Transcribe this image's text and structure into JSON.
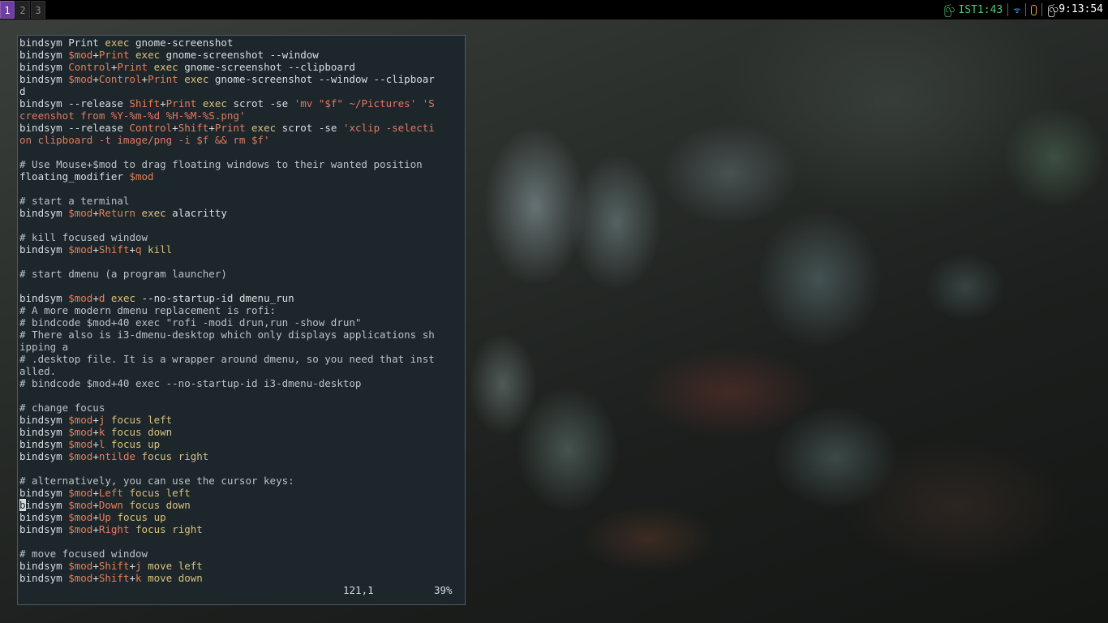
{
  "workspaces": [
    "1",
    "2",
    "3"
  ],
  "active_workspace": "1",
  "status": {
    "cpu": "IST1:43",
    "cpu_icon": "ꩺ",
    "wifi_icon": "ᯤ",
    "temp_icon": "🌡",
    "clock": "ꩺ9:13:54"
  },
  "colors": {
    "bar_bg": "#000000",
    "active_ws": "#6f3f9f",
    "terminal_bg": "#1d262b",
    "variable": "#e67e5a",
    "keyword": "#d8c27a"
  },
  "editor": {
    "cursor_position": "121,1",
    "scroll_percent": "39%",
    "lines": [
      [
        [
          "t",
          "bindsym Print "
        ],
        [
          "k",
          "exec"
        ],
        [
          "t",
          " gnome-screenshot"
        ]
      ],
      [
        [
          "t",
          "bindsym "
        ],
        [
          "v",
          "$mod"
        ],
        [
          "t",
          "+"
        ],
        [
          "v",
          "Print"
        ],
        [
          "t",
          " "
        ],
        [
          "k",
          "exec"
        ],
        [
          "t",
          " gnome-screenshot --window"
        ]
      ],
      [
        [
          "t",
          "bindsym "
        ],
        [
          "v",
          "Control"
        ],
        [
          "t",
          "+"
        ],
        [
          "v",
          "Print"
        ],
        [
          "t",
          " "
        ],
        [
          "k",
          "exec"
        ],
        [
          "t",
          " gnome-screenshot --clipboard"
        ]
      ],
      [
        [
          "t",
          "bindsym "
        ],
        [
          "v",
          "$mod"
        ],
        [
          "t",
          "+"
        ],
        [
          "v",
          "Control"
        ],
        [
          "t",
          "+"
        ],
        [
          "v",
          "Print"
        ],
        [
          "t",
          " "
        ],
        [
          "k",
          "exec"
        ],
        [
          "t",
          " gnome-screenshot --window --clipboar"
        ]
      ],
      [
        [
          "t",
          "d"
        ]
      ],
      [
        [
          "t",
          "bindsym --release "
        ],
        [
          "v",
          "Shift"
        ],
        [
          "t",
          "+"
        ],
        [
          "v",
          "Print"
        ],
        [
          "t",
          " "
        ],
        [
          "k",
          "exec"
        ],
        [
          "t",
          " scrot -se "
        ],
        [
          "s",
          "'mv \"$f\" ~/Pictures' 'S"
        ]
      ],
      [
        [
          "s",
          "creenshot from %Y-%m-%d %H-%M-%S.png'"
        ]
      ],
      [
        [
          "t",
          "bindsym --release "
        ],
        [
          "v",
          "Control"
        ],
        [
          "t",
          "+"
        ],
        [
          "v",
          "Shift"
        ],
        [
          "t",
          "+"
        ],
        [
          "v",
          "Print"
        ],
        [
          "t",
          " "
        ],
        [
          "k",
          "exec"
        ],
        [
          "t",
          " scrot -se "
        ],
        [
          "s",
          "'xclip -selecti"
        ]
      ],
      [
        [
          "s",
          "on clipboard -t image/png -i $f && rm $f'"
        ]
      ],
      [
        [
          "t",
          ""
        ]
      ],
      [
        [
          "c",
          "# Use Mouse+$mod to drag floating windows to their wanted position"
        ]
      ],
      [
        [
          "t",
          "floating_modifier "
        ],
        [
          "v",
          "$mod"
        ]
      ],
      [
        [
          "t",
          ""
        ]
      ],
      [
        [
          "c",
          "# start a terminal"
        ]
      ],
      [
        [
          "t",
          "bindsym "
        ],
        [
          "v",
          "$mod"
        ],
        [
          "t",
          "+"
        ],
        [
          "v",
          "Return"
        ],
        [
          "t",
          " "
        ],
        [
          "k",
          "exec"
        ],
        [
          "t",
          " alacritty"
        ]
      ],
      [
        [
          "t",
          ""
        ]
      ],
      [
        [
          "c",
          "# kill focused window"
        ]
      ],
      [
        [
          "t",
          "bindsym "
        ],
        [
          "v",
          "$mod"
        ],
        [
          "t",
          "+"
        ],
        [
          "v",
          "Shift"
        ],
        [
          "t",
          "+"
        ],
        [
          "v",
          "q"
        ],
        [
          "t",
          " "
        ],
        [
          "k",
          "kill"
        ]
      ],
      [
        [
          "t",
          ""
        ]
      ],
      [
        [
          "c",
          "# start dmenu (a program launcher)"
        ]
      ],
      [
        [
          "t",
          ""
        ]
      ],
      [
        [
          "t",
          "bindsym "
        ],
        [
          "v",
          "$mod"
        ],
        [
          "t",
          "+"
        ],
        [
          "v",
          "d"
        ],
        [
          "t",
          " "
        ],
        [
          "k",
          "exec"
        ],
        [
          "t",
          " --no-startup-id dmenu_run"
        ]
      ],
      [
        [
          "c",
          "# A more modern dmenu replacement is rofi:"
        ]
      ],
      [
        [
          "c",
          "# bindcode $mod+40 exec \"rofi -modi drun,run -show drun\""
        ]
      ],
      [
        [
          "c",
          "# There also is i3-dmenu-desktop which only displays applications sh"
        ]
      ],
      [
        [
          "c",
          "ipping a"
        ]
      ],
      [
        [
          "c",
          "# .desktop file. It is a wrapper around dmenu, so you need that inst"
        ]
      ],
      [
        [
          "c",
          "alled."
        ]
      ],
      [
        [
          "c",
          "# bindcode $mod+40 exec --no-startup-id i3-dmenu-desktop"
        ]
      ],
      [
        [
          "t",
          ""
        ]
      ],
      [
        [
          "c",
          "# change focus"
        ]
      ],
      [
        [
          "t",
          "bindsym "
        ],
        [
          "v",
          "$mod"
        ],
        [
          "t",
          "+"
        ],
        [
          "v",
          "j"
        ],
        [
          "t",
          " "
        ],
        [
          "k",
          "focus left"
        ]
      ],
      [
        [
          "t",
          "bindsym "
        ],
        [
          "v",
          "$mod"
        ],
        [
          "t",
          "+"
        ],
        [
          "v",
          "k"
        ],
        [
          "t",
          " "
        ],
        [
          "k",
          "focus down"
        ]
      ],
      [
        [
          "t",
          "bindsym "
        ],
        [
          "v",
          "$mod"
        ],
        [
          "t",
          "+"
        ],
        [
          "v",
          "l"
        ],
        [
          "t",
          " "
        ],
        [
          "k",
          "focus up"
        ]
      ],
      [
        [
          "t",
          "bindsym "
        ],
        [
          "v",
          "$mod"
        ],
        [
          "t",
          "+"
        ],
        [
          "v",
          "ntilde"
        ],
        [
          "t",
          " "
        ],
        [
          "k",
          "focus right"
        ]
      ],
      [
        [
          "t",
          ""
        ]
      ],
      [
        [
          "c",
          "# alternatively, you can use the cursor keys:"
        ]
      ],
      [
        [
          "t",
          "bindsym "
        ],
        [
          "v",
          "$mod"
        ],
        [
          "t",
          "+"
        ],
        [
          "v",
          "Left"
        ],
        [
          "t",
          " "
        ],
        [
          "k",
          "focus left"
        ]
      ],
      [
        [
          "u",
          "b"
        ],
        [
          "t",
          "indsym "
        ],
        [
          "v",
          "$mod"
        ],
        [
          "t",
          "+"
        ],
        [
          "v",
          "Down"
        ],
        [
          "t",
          " "
        ],
        [
          "k",
          "focus down"
        ]
      ],
      [
        [
          "t",
          "bindsym "
        ],
        [
          "v",
          "$mod"
        ],
        [
          "t",
          "+"
        ],
        [
          "v",
          "Up"
        ],
        [
          "t",
          " "
        ],
        [
          "k",
          "focus up"
        ]
      ],
      [
        [
          "t",
          "bindsym "
        ],
        [
          "v",
          "$mod"
        ],
        [
          "t",
          "+"
        ],
        [
          "v",
          "Right"
        ],
        [
          "t",
          " "
        ],
        [
          "k",
          "focus right"
        ]
      ],
      [
        [
          "t",
          ""
        ]
      ],
      [
        [
          "c",
          "# move focused window"
        ]
      ],
      [
        [
          "t",
          "bindsym "
        ],
        [
          "v",
          "$mod"
        ],
        [
          "t",
          "+"
        ],
        [
          "v",
          "Shift"
        ],
        [
          "t",
          "+"
        ],
        [
          "v",
          "j"
        ],
        [
          "t",
          " "
        ],
        [
          "k",
          "move left"
        ]
      ],
      [
        [
          "t",
          "bindsym "
        ],
        [
          "v",
          "$mod"
        ],
        [
          "t",
          "+"
        ],
        [
          "v",
          "Shift"
        ],
        [
          "t",
          "+"
        ],
        [
          "v",
          "k"
        ],
        [
          "t",
          " "
        ],
        [
          "k",
          "move down"
        ]
      ]
    ]
  }
}
